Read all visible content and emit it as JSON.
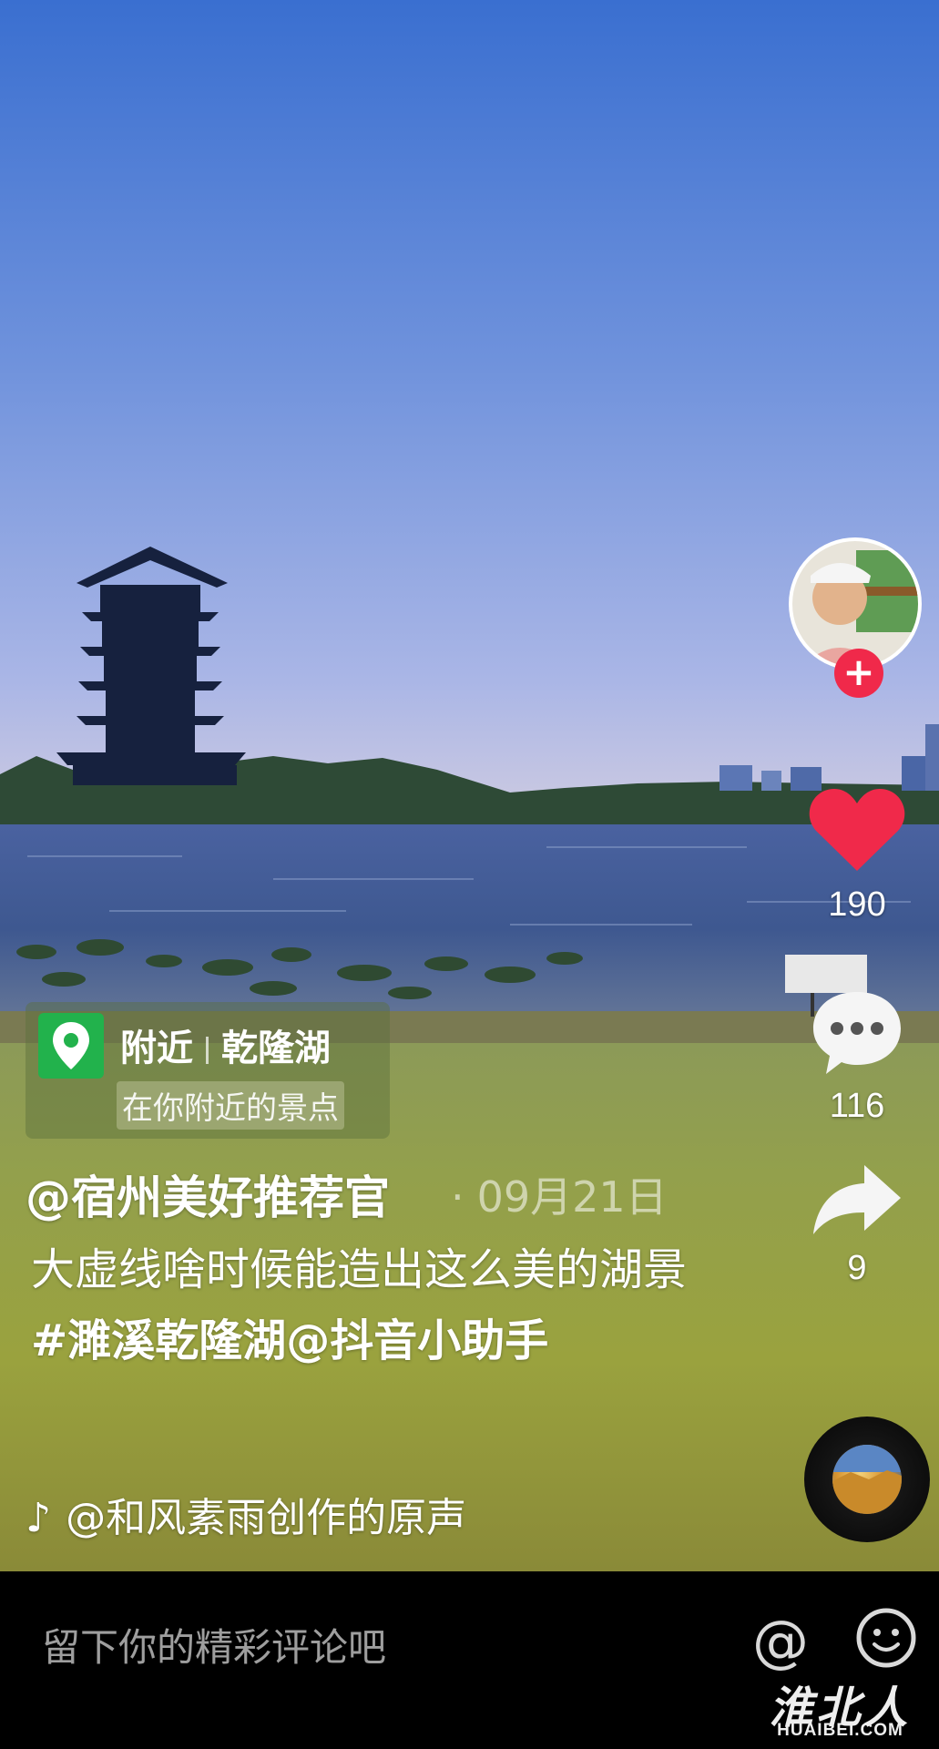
{
  "video": {
    "author": "@宿州美好推荐官",
    "date": "09月21日",
    "caption_text": "大虚线啥时候能造出这么美的湖景",
    "caption_hashtag": "#濉溪乾隆湖",
    "caption_mention": "@抖音小助手",
    "music": "@和风素雨创作的原声"
  },
  "poi": {
    "icon": "location-pin-icon",
    "tag": "附近",
    "name": "乾隆湖",
    "subtitle": "在你附近的景点"
  },
  "actions": {
    "likes": "190",
    "comments": "116",
    "shares": "9",
    "follow_icon": "plus-icon",
    "like_icon": "heart-icon",
    "comment_icon": "speech-bubble-icon",
    "share_icon": "share-arrow-icon",
    "music_icon": "music-disc-icon"
  },
  "comment_bar": {
    "placeholder": "留下你的精彩评论吧",
    "at_icon": "at-icon",
    "emoji_icon": "emoji-icon"
  },
  "watermark": {
    "big": "淮北人",
    "small": "HUAIBEI.COM"
  },
  "colors": {
    "like": "#f0294a",
    "poi_green": "#22b24c"
  }
}
